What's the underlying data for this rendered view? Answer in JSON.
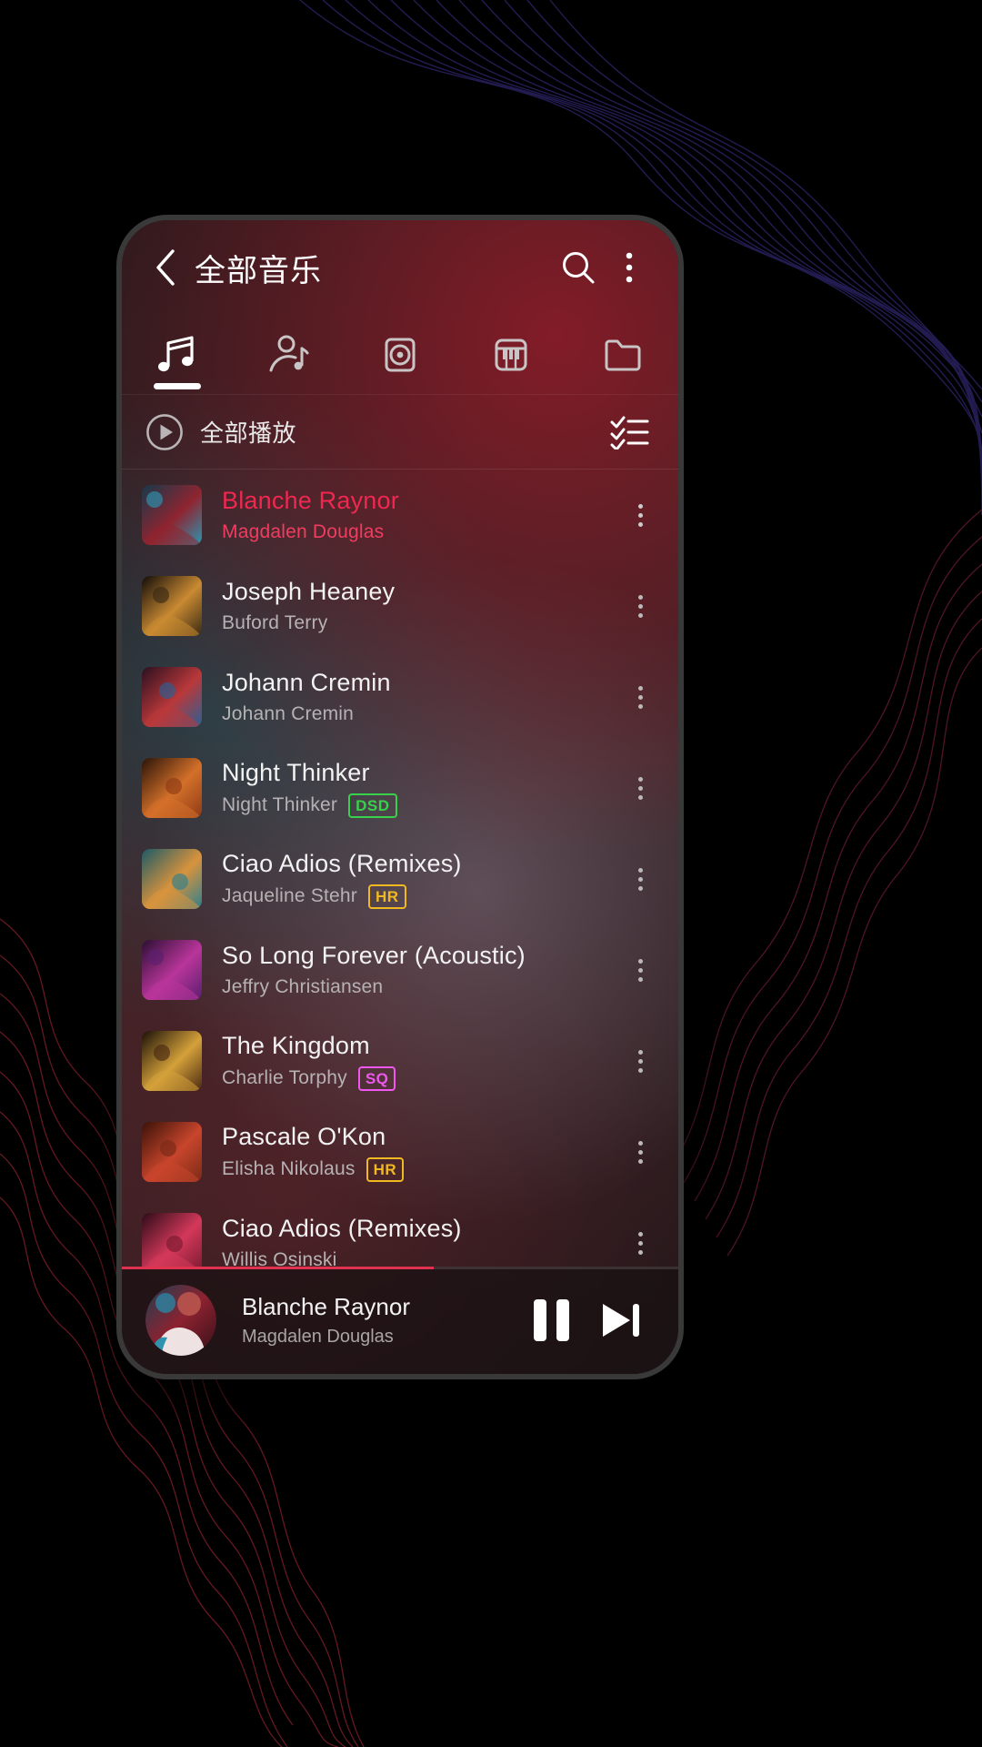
{
  "header": {
    "back_icon": "chevron-left-icon",
    "title": "全部音乐",
    "search_icon": "search-icon",
    "overflow_icon": "more-vertical-icon"
  },
  "tabs": [
    {
      "icon": "music-note-icon",
      "name": "songs",
      "active": true
    },
    {
      "icon": "artist-icon",
      "name": "artists",
      "active": false
    },
    {
      "icon": "album-disc-icon",
      "name": "albums",
      "active": false
    },
    {
      "icon": "piano-icon",
      "name": "genres",
      "active": false
    },
    {
      "icon": "folder-icon",
      "name": "folders",
      "active": false
    }
  ],
  "playall": {
    "play_icon": "play-circle-icon",
    "label": "全部播放",
    "multiselect_icon": "checklist-icon"
  },
  "songs": [
    {
      "title": "Blanche Raynor",
      "artist": "Magdalen Douglas",
      "badge": "",
      "playing": true
    },
    {
      "title": "Joseph Heaney",
      "artist": "Buford Terry",
      "badge": "",
      "playing": false
    },
    {
      "title": "Johann Cremin",
      "artist": "Johann Cremin",
      "badge": "",
      "playing": false
    },
    {
      "title": "Night Thinker",
      "artist": "Night Thinker",
      "badge": "DSD",
      "playing": false
    },
    {
      "title": "Ciao Adios (Remixes)",
      "artist": "Jaqueline Stehr",
      "badge": "HR",
      "playing": false
    },
    {
      "title": "So Long Forever (Acoustic)",
      "artist": "Jeffry Christiansen",
      "badge": "",
      "playing": false
    },
    {
      "title": "The Kingdom",
      "artist": "Charlie Torphy",
      "badge": "SQ",
      "playing": false
    },
    {
      "title": "Pascale O'Kon",
      "artist": "Elisha Nikolaus",
      "badge": "HR",
      "playing": false
    },
    {
      "title": "Ciao Adios (Remixes)",
      "artist": "Willis Osinski",
      "badge": "",
      "playing": false
    }
  ],
  "player": {
    "title": "Blanche Raynor",
    "artist": "Magdalen Douglas",
    "pause_icon": "pause-icon",
    "next_icon": "skip-next-icon",
    "progress_percent": 56
  },
  "colors": {
    "accent_playing": "#f0274f",
    "badge_dsd": "#37d24a",
    "badge_hr": "#f0b921",
    "badge_sq": "#ef57f0",
    "progress": "#e0324f"
  }
}
